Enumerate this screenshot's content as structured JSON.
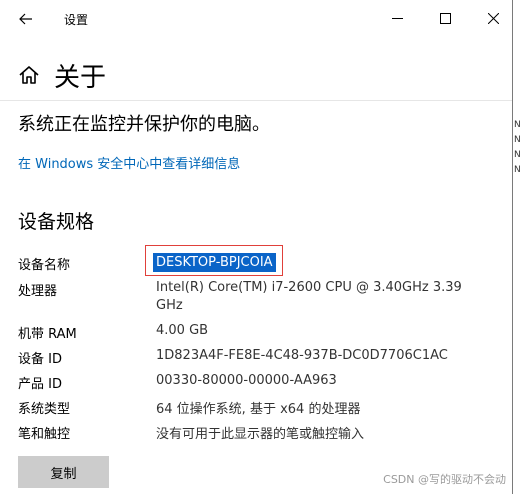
{
  "window": {
    "title": "设置"
  },
  "page": {
    "title": "关于"
  },
  "status": {
    "text": "系统正在监控并保护你的电脑。",
    "link": "在 Windows 安全中心中查看详细信息"
  },
  "specs": {
    "title": "设备规格",
    "rows": [
      {
        "label": "设备名称",
        "value": "DESKTOP-BPJCOIA"
      },
      {
        "label": "处理器",
        "value": "Intel(R) Core(TM) i7-2600 CPU @ 3.40GHz   3.39",
        "value2": "GHz"
      },
      {
        "label": "机带 RAM",
        "value": "4.00 GB"
      },
      {
        "label": "设备 ID",
        "value": "1D823A4F-FE8E-4C48-937B-DC0D7706C1AC"
      },
      {
        "label": "产品 ID",
        "value": "00330-80000-00000-AA963"
      },
      {
        "label": "系统类型",
        "value": "64 位操作系统, 基于 x64 的处理器"
      },
      {
        "label": "笔和触控",
        "value": "没有可用于此显示器的笔或触控输入"
      }
    ]
  },
  "actions": {
    "copy_label": "复制"
  },
  "watermark": "CSDN @写的驱动不会动",
  "outside_fragments": [
    "N",
    "N",
    "N",
    "N"
  ],
  "colors": {
    "link": "#0067b8",
    "selection": "#0a64c8",
    "highlight_border": "#e0403a",
    "button": "#cccccc"
  },
  "icons": {
    "back": "back-arrow-icon",
    "home": "home-icon",
    "minimize": "minimize-icon",
    "maximize": "maximize-icon",
    "close": "close-icon"
  }
}
